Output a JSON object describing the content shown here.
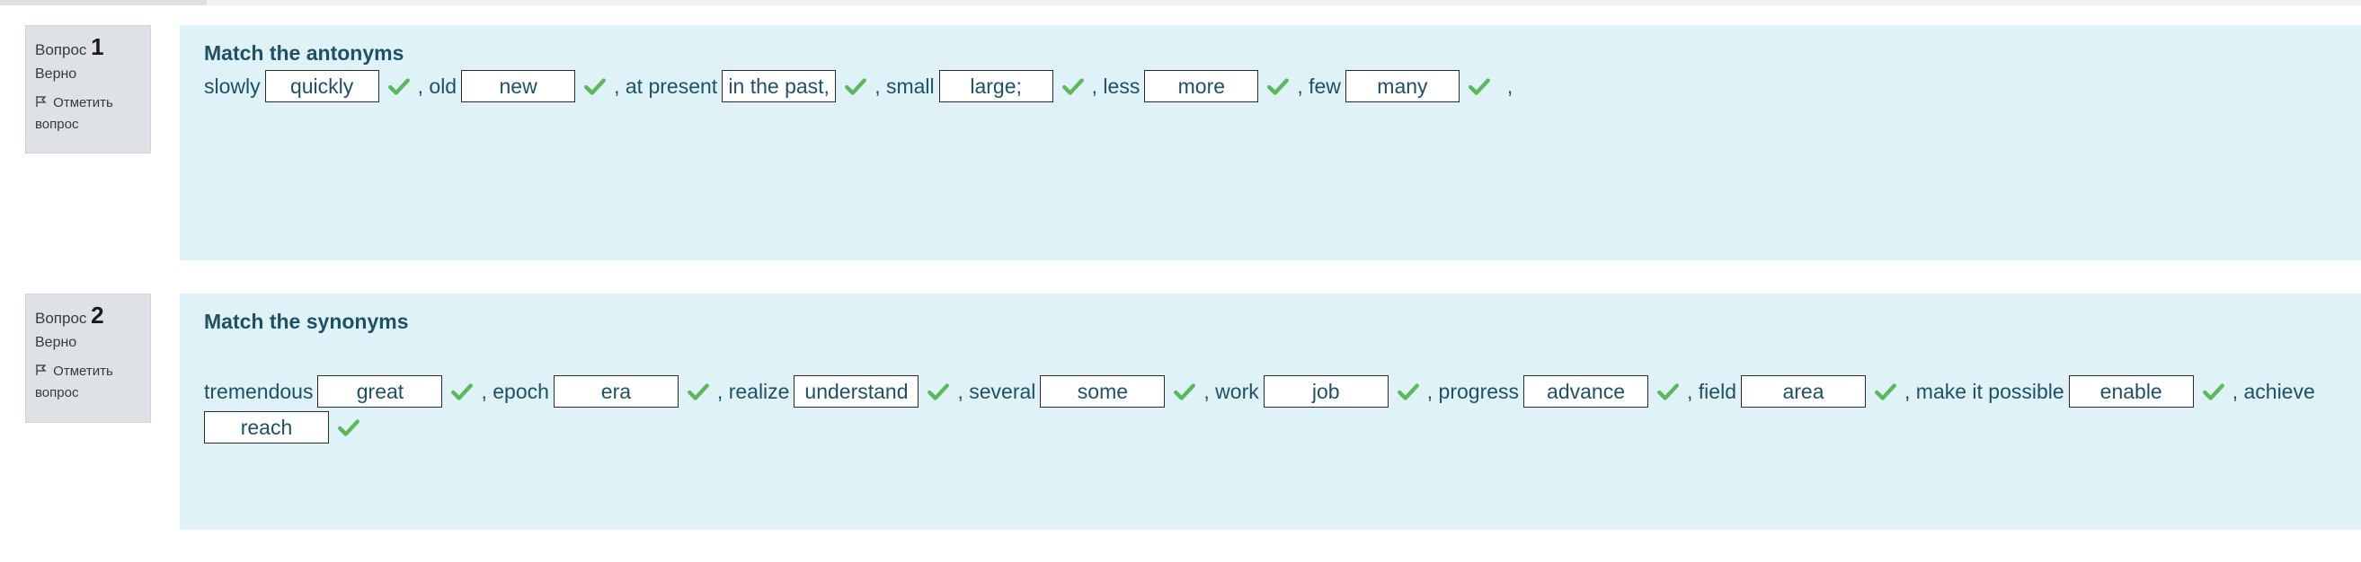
{
  "questions": [
    {
      "label": "Вопрос",
      "number": "1",
      "state": "Верно",
      "flag_label": "Отметить вопрос",
      "title": "Match the antonyms",
      "trailing": ","
    },
    {
      "label": "Вопрос",
      "number": "2",
      "state": "Верно",
      "flag_label": "Отметить вопрос",
      "title": "Match the synonyms"
    }
  ],
  "q1_items": [
    {
      "word": "slowly",
      "answer": "quickly"
    },
    {
      "word": ", old",
      "answer": "new"
    },
    {
      "word": ", at present",
      "answer": "in the past,"
    },
    {
      "word": ", small",
      "answer": "large;"
    },
    {
      "word": ", less",
      "answer": "more"
    },
    {
      "word": ", few",
      "answer": "many"
    }
  ],
  "q2_items": [
    {
      "word": "tremendous",
      "answer": "great"
    },
    {
      "word": ", epoch",
      "answer": "era"
    },
    {
      "word": ", realize",
      "answer": "understand"
    },
    {
      "word": ", several",
      "answer": "some"
    },
    {
      "word": ", work",
      "answer": "job"
    },
    {
      "word": ", progress",
      "answer": "advance"
    },
    {
      "word": ", field",
      "answer": "area"
    },
    {
      "word": ", make it possible",
      "answer": "enable"
    },
    {
      "word": ", achieve",
      "answer": "reach"
    }
  ],
  "colors": {
    "correct": "#5cb85c",
    "panel": "#def2f8",
    "info": "#dee2e6"
  },
  "icons": {
    "correct": "check-icon",
    "flag": "flag-icon"
  }
}
